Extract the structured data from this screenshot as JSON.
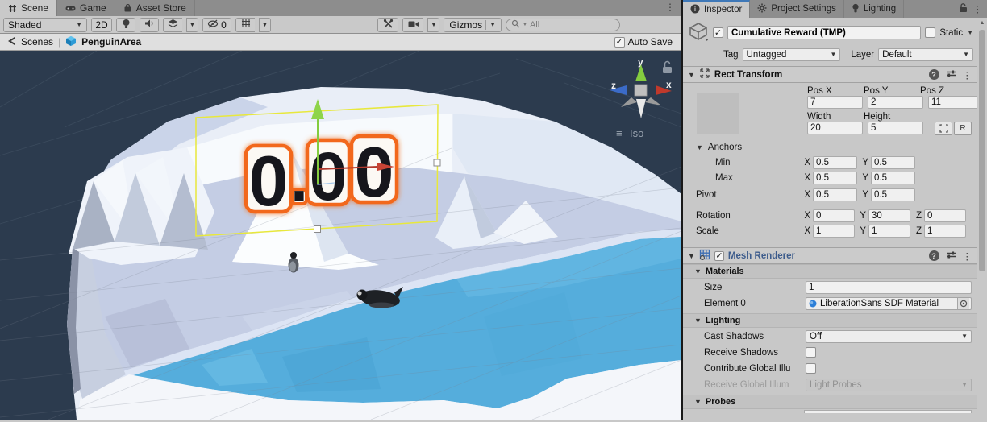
{
  "tabs": {
    "scene": "Scene",
    "game": "Game",
    "asset_store": "Asset Store"
  },
  "toolbar": {
    "shading_mode": "Shaded",
    "mode_2d": "2D",
    "visibility_count": "0",
    "gizmos_label": "Gizmos",
    "search_placeholder": "All"
  },
  "breadcrumb": {
    "scenes_label": "Scenes",
    "scene_name": "PenguinArea",
    "auto_save_label": "Auto Save"
  },
  "viewport": {
    "reward_text": "0.00",
    "reward_chars": [
      "0",
      ".",
      "0",
      "0"
    ],
    "iso_label": "Iso",
    "axis_x": "x",
    "axis_y": "y",
    "axis_z": "z"
  },
  "inspector": {
    "tabs": {
      "inspector": "Inspector",
      "project_settings": "Project Settings",
      "lighting": "Lighting"
    },
    "header": {
      "name": "Cumulative Reward (TMP)",
      "static_label": "Static",
      "tag_label": "Tag",
      "tag_value": "Untagged",
      "layer_label": "Layer",
      "layer_value": "Default"
    },
    "rect_transform": {
      "title": "Rect Transform",
      "pos_x_label": "Pos X",
      "pos_y_label": "Pos Y",
      "pos_z_label": "Pos Z",
      "pos_x": "7",
      "pos_y": "2",
      "pos_z": "11",
      "width_label": "Width",
      "height_label": "Height",
      "width": "20",
      "height": "5",
      "r_button": "R",
      "anchors_label": "Anchors",
      "min_label": "Min",
      "max_label": "Max",
      "pivot_label": "Pivot",
      "x_prefix": "X",
      "y_prefix": "Y",
      "z_prefix": "Z",
      "anchor_min_x": "0.5",
      "anchor_min_y": "0.5",
      "anchor_max_x": "0.5",
      "anchor_max_y": "0.5",
      "pivot_x": "0.5",
      "pivot_y": "0.5",
      "rotation_label": "Rotation",
      "rotation_x": "0",
      "rotation_y": "30",
      "rotation_z": "0",
      "scale_label": "Scale",
      "scale_x": "1",
      "scale_y": "1",
      "scale_z": "1"
    },
    "mesh_renderer": {
      "title": "Mesh Renderer",
      "materials_label": "Materials",
      "size_label": "Size",
      "size": "1",
      "element0_label": "Element 0",
      "element0_value": "LiberationSans SDF Material",
      "lighting_label": "Lighting",
      "cast_shadows_label": "Cast Shadows",
      "cast_shadows": "Off",
      "receive_shadows_label": "Receive Shadows",
      "contribute_gi_label": "Contribute Global Illu",
      "receive_gi_label": "Receive Global Illum",
      "receive_gi": "Light Probes",
      "probes_label": "Probes"
    }
  },
  "colors": {
    "water_blue": "#55ADDC",
    "outline_orange": "#F2671E",
    "gizmo_yellow": "#E8E83C",
    "axis_green": "#84CC3F",
    "axis_red": "#C0392B",
    "prefab_override_blue": "#3D5C8C",
    "scene_background": "#2C3B4E"
  }
}
